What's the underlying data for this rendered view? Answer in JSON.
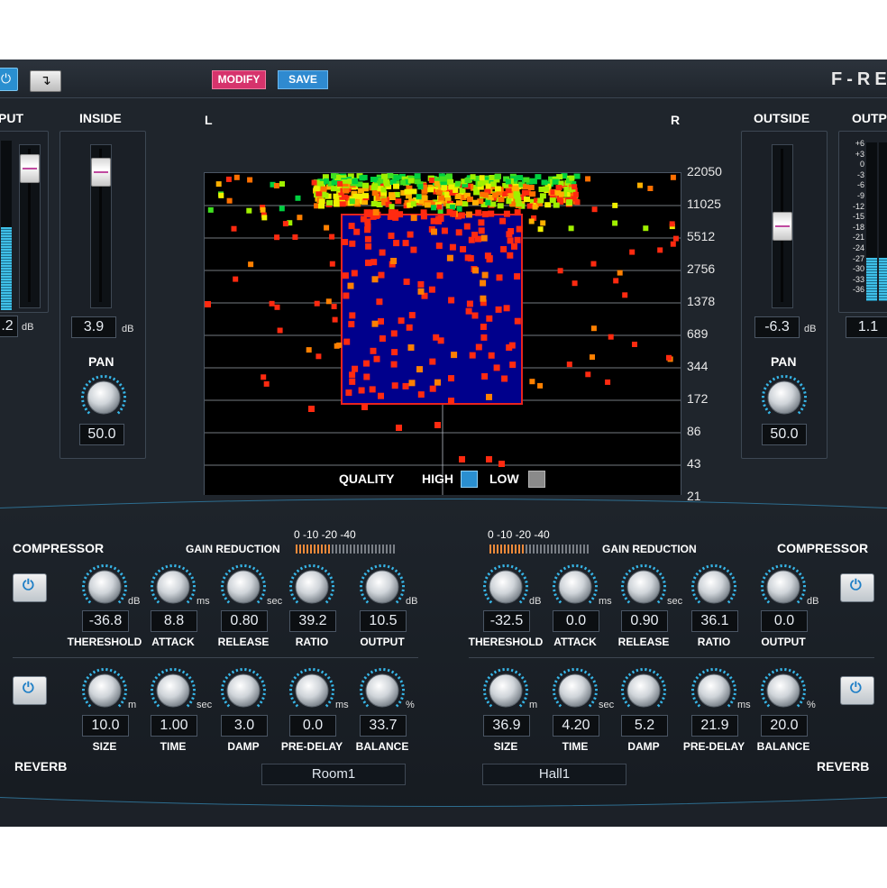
{
  "toolbar": {
    "power_glyph": "⏻",
    "route_glyph": "↴",
    "modify_label": "MODIFY",
    "save_label": "SAVE",
    "brand": "F-RE"
  },
  "left": {
    "input_label": "PUT",
    "input_value": ".2",
    "input_unit": "dB",
    "inside_label": "INSIDE",
    "inside_value": "3.9",
    "inside_unit": "dB",
    "pan_label": "PAN",
    "pan_value": "50.0"
  },
  "right": {
    "outside_label": "OUTSIDE",
    "outside_value": "-6.3",
    "outside_unit": "dB",
    "output_label": "OUTP",
    "output_value": "1.1",
    "pan_label": "PAN",
    "pan_value": "50.0",
    "meter_scale": [
      "+6",
      "+3",
      "0",
      "-3",
      "-6",
      "-9",
      "-12",
      "-15",
      "-18",
      "-21",
      "-24",
      "-27",
      "-30",
      "-33",
      "-36"
    ]
  },
  "display": {
    "left_channel": "L",
    "right_channel": "R",
    "freq_labels": [
      "22050",
      "11025",
      "5512",
      "2756",
      "1378",
      "689",
      "344",
      "172",
      "86",
      "43",
      "21"
    ],
    "quality_label": "QUALITY",
    "high_label": "HIGH",
    "low_label": "LOW",
    "high_color": "#2a8fd0",
    "low_color": "#8a8a8a"
  },
  "left_comp": {
    "title": "COMPRESSOR",
    "gr_label": "GAIN REDUCTION",
    "gr_ticks": "0    -10 -20 -40",
    "knobs": [
      {
        "label": "THERESHOLD",
        "value": "-36.8",
        "unit": "dB"
      },
      {
        "label": "ATTACK",
        "value": "8.8",
        "unit": "ms"
      },
      {
        "label": "RELEASE",
        "value": "0.80",
        "unit": "sec"
      },
      {
        "label": "RATIO",
        "value": "39.2",
        "unit": ""
      },
      {
        "label": "OUTPUT",
        "value": "10.5",
        "unit": "dB"
      }
    ]
  },
  "right_comp": {
    "title": "COMPRESSOR",
    "gr_label": "GAIN REDUCTION",
    "gr_ticks": "0    -10 -20 -40",
    "knobs": [
      {
        "label": "THERESHOLD",
        "value": "-32.5",
        "unit": "dB"
      },
      {
        "label": "ATTACK",
        "value": "0.0",
        "unit": "ms"
      },
      {
        "label": "RELEASE",
        "value": "0.90",
        "unit": "sec"
      },
      {
        "label": "RATIO",
        "value": "36.1",
        "unit": ""
      },
      {
        "label": "OUTPUT",
        "value": "0.0",
        "unit": "dB"
      }
    ]
  },
  "left_reverb": {
    "title": "REVERB",
    "preset": "Room1",
    "knobs": [
      {
        "label": "SIZE",
        "value": "10.0",
        "unit": "m"
      },
      {
        "label": "TIME",
        "value": "1.00",
        "unit": "sec"
      },
      {
        "label": "DAMP",
        "value": "3.0",
        "unit": ""
      },
      {
        "label": "PRE-DELAY",
        "value": "0.0",
        "unit": "ms"
      },
      {
        "label": "BALANCE",
        "value": "33.7",
        "unit": "%"
      }
    ]
  },
  "right_reverb": {
    "title": "REVERB",
    "preset": "Hall1",
    "knobs": [
      {
        "label": "SIZE",
        "value": "36.9",
        "unit": "m"
      },
      {
        "label": "TIME",
        "value": "4.20",
        "unit": "sec"
      },
      {
        "label": "DAMP",
        "value": "5.2",
        "unit": ""
      },
      {
        "label": "PRE-DELAY",
        "value": "21.9",
        "unit": "ms"
      },
      {
        "label": "BALANCE",
        "value": "20.0",
        "unit": "%"
      }
    ]
  },
  "colors": {
    "accent_blue": "#2a8fd0",
    "modify_pink": "#d6336c",
    "meter_cyan": "#3fc0e8",
    "gr_orange": "#f08a3a",
    "region_blue": "#00008c",
    "region_red": "#e8241e"
  }
}
